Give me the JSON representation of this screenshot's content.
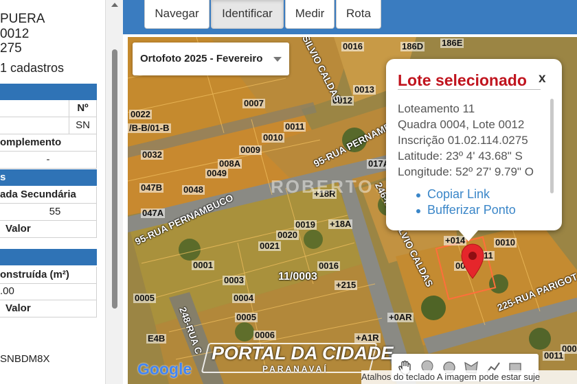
{
  "left_panel": {
    "lines": [
      "PUERA",
      "0012",
      "275"
    ],
    "count_text": "1 cadastros",
    "row_n_label": "Nº",
    "row_n_value": "SN",
    "complemento_label": "omplemento",
    "complemento_value": "-",
    "section_s": "s",
    "entrada_label": "ada Secundária",
    "entrada_value": "55",
    "valor_label_1": "Valor",
    "area_label": "onstruída (m²)",
    "area_value": ".00",
    "valor_label_2": "Valor",
    "code": "SNBDM8X"
  },
  "toolbar": {
    "navegar": "Navegar",
    "identificar": "Identificar",
    "medir": "Medir",
    "rota": "Rota"
  },
  "map": {
    "layer_select": "Ortofoto 2025 - Fevereiro",
    "parcels": [
      "0016",
      "186D",
      "186E",
      "0012",
      "0013",
      "0007",
      "0022",
      "/B-B/01-B",
      "0011",
      "0010",
      "0032",
      "0009",
      "008A",
      "0049",
      "017A",
      "047B",
      "0048",
      "+18R",
      "047A",
      "0019",
      "+18A",
      "0020",
      "0021",
      "+014",
      "0010",
      "0001",
      "0016",
      "0003",
      "+215",
      "0005",
      "0004",
      "0005",
      "+0AR",
      "E4B",
      "0006",
      "+A1R",
      "0005",
      "0011",
      "00",
      "11"
    ],
    "streets": [
      "95-RUA PERNAMBUCO",
      "95-RUA PERNAMBUCO",
      "246-RUA SILVIO CALDAS",
      "SILVIO CALDAS",
      "225-RUA PARIGOT",
      "248-RUA C"
    ],
    "block_label": "11/0003",
    "watermark_roberto": "ROBERTO",
    "watermark_portal": "PORTAL DA CIDADE",
    "watermark_portal_sub": "PARANAVAÍ",
    "google": "Google",
    "attribution": "Atalhos do teclado  A imagem pode estar suje"
  },
  "popup": {
    "title": "Lote selecionado",
    "close": "x",
    "loteamento": "Loteamento 11",
    "quadra_lote": "Quadra 0004, Lote 0012",
    "inscricao": "Inscrição 01.02.114.0275",
    "latitude": "Latitude: 23º 4' 43.68\" S",
    "longitude": "Longitude: 52º 27' 9.79\" O",
    "link_copy": "Copiar Link",
    "link_buffer": "Bufferizar Ponto"
  },
  "icons": {
    "pin": "map-pin-icon",
    "hand": "hand-icon",
    "marker": "marker-icon",
    "circle": "circle-icon",
    "polygon": "polygon-icon",
    "line": "polyline-icon",
    "rect": "rectangle-icon"
  },
  "colors": {
    "toolbar": "#3a7cc0",
    "section_header": "#2f73b6",
    "popup_title": "#c0141e",
    "link": "#3a86c8",
    "pin": "#e5262b"
  }
}
